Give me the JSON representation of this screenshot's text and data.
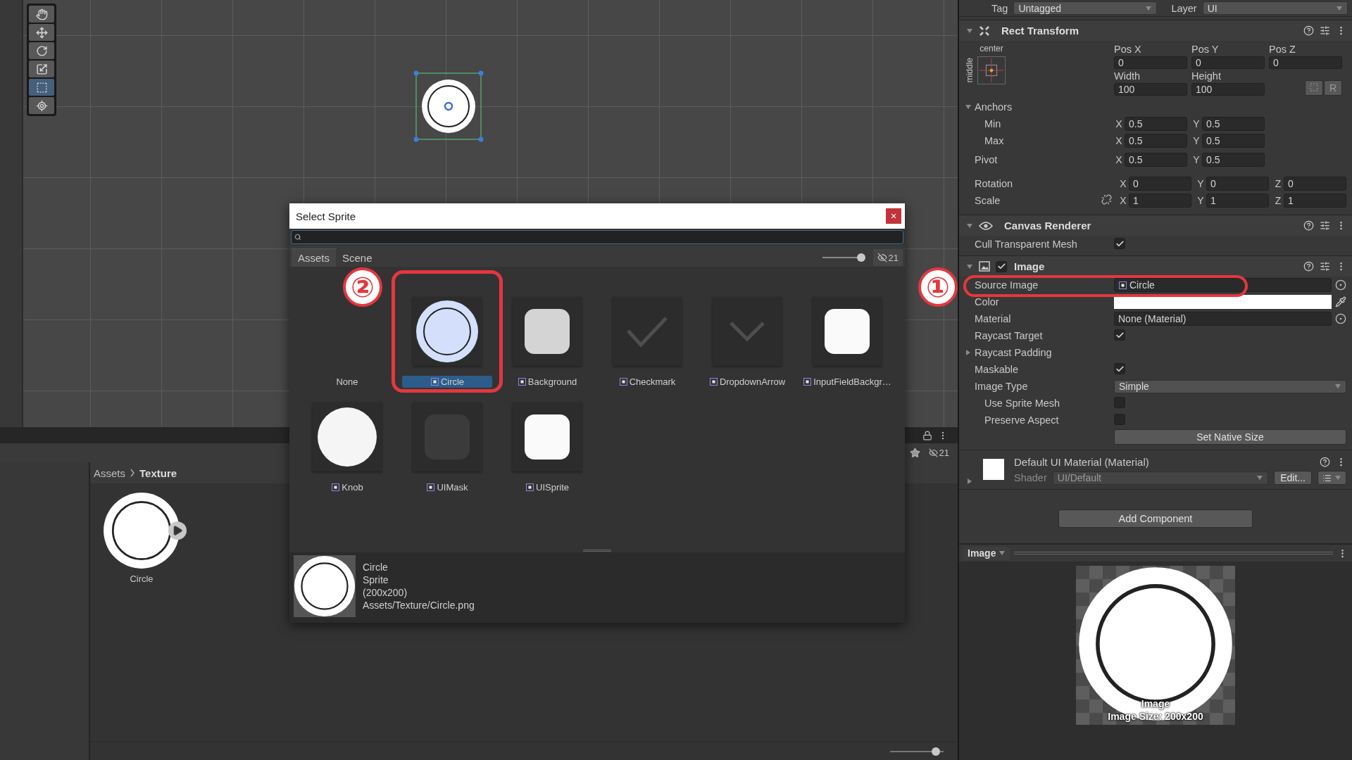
{
  "scene": {
    "tools": [
      {
        "kind": "hand",
        "selected": false
      },
      {
        "kind": "move",
        "selected": false
      },
      {
        "kind": "rotate",
        "selected": false
      },
      {
        "kind": "scale",
        "selected": false
      },
      {
        "kind": "rect",
        "selected": true
      },
      {
        "kind": "transform",
        "selected": false
      }
    ]
  },
  "project": {
    "hidden_count": "21",
    "breadcrumb": [
      "Assets",
      "Texture"
    ],
    "items": [
      {
        "name": "Circle"
      }
    ],
    "zoom": {
      "level": 0.85
    }
  },
  "dialog": {
    "title": "Select Sprite",
    "close": "×",
    "tabs": [
      {
        "label": "Assets",
        "selected": true
      },
      {
        "label": "Scene",
        "selected": false
      }
    ],
    "size": {
      "level": 0.92
    },
    "hidden_count": "21",
    "sprites": [
      {
        "name": "None",
        "kind": "none",
        "selected": false
      },
      {
        "name": "Circle",
        "kind": "ring",
        "selected": true
      },
      {
        "name": "Background",
        "kind": "rounded-gray",
        "selected": false
      },
      {
        "name": "Checkmark",
        "kind": "check",
        "selected": false
      },
      {
        "name": "DropdownArrow",
        "kind": "chevron",
        "selected": false
      },
      {
        "name": "InputFieldBackgr…",
        "kind": "rounded-white",
        "selected": false
      },
      {
        "name": "Knob",
        "kind": "disc",
        "selected": false
      },
      {
        "name": "UIMask",
        "kind": "rounded-dark",
        "selected": false
      },
      {
        "name": "UISprite",
        "kind": "rounded-white",
        "selected": false
      }
    ],
    "preview": {
      "lines": [
        "Circle",
        "Sprite",
        "(200x200)",
        "Assets/Texture/Circle.png"
      ]
    }
  },
  "inspector": {
    "tag": {
      "label": "Tag",
      "value": "Untagged"
    },
    "layer": {
      "label": "Layer",
      "value": "UI"
    },
    "rect_transform": {
      "title": "Rect Transform",
      "expanded": true,
      "preset": {
        "horizontal": "center",
        "vertical": "middle"
      },
      "size_fields": [
        {
          "label": "Pos X",
          "value": "0"
        },
        {
          "label": "Pos Y",
          "value": "0"
        },
        {
          "label": "Pos Z",
          "value": "0"
        },
        {
          "label": "Width",
          "value": "100"
        },
        {
          "label": "Height",
          "value": "100"
        }
      ],
      "raw_button": "R",
      "anchors": {
        "label": "Anchors",
        "expanded": true,
        "rows": [
          {
            "label": "Min",
            "fields": [
              {
                "axis": "X",
                "value": "0.5"
              },
              {
                "axis": "Y",
                "value": "0.5"
              }
            ]
          },
          {
            "label": "Max",
            "fields": [
              {
                "axis": "X",
                "value": "0.5"
              },
              {
                "axis": "Y",
                "value": "0.5"
              }
            ]
          }
        ]
      },
      "pivot": {
        "label": "Pivot",
        "fields": [
          {
            "axis": "X",
            "value": "0.5"
          },
          {
            "axis": "Y",
            "value": "0.5"
          }
        ]
      },
      "rows": [
        {
          "label": "Rotation",
          "constrained": null,
          "fields": [
            {
              "axis": "X",
              "value": "0"
            },
            {
              "axis": "Y",
              "value": "0"
            },
            {
              "axis": "Z",
              "value": "0"
            }
          ]
        },
        {
          "label": "Scale",
          "constrained": false,
          "fields": [
            {
              "axis": "X",
              "value": "1"
            },
            {
              "axis": "Y",
              "value": "1"
            },
            {
              "axis": "Z",
              "value": "1"
            }
          ]
        }
      ]
    },
    "canvas_renderer": {
      "title": "Canvas Renderer",
      "expanded": true,
      "rows": [
        {
          "label": "Cull Transparent Mesh",
          "kind": "checkbox",
          "checked": true
        }
      ]
    },
    "image": {
      "title": "Image",
      "expanded": true,
      "enabled": true,
      "rows": [
        {
          "label": "Source Image",
          "kind": "object",
          "value": "Circle",
          "sprite": true
        },
        {
          "label": "Color",
          "kind": "color",
          "color": "#ffffff"
        },
        {
          "label": "Material",
          "kind": "object",
          "value": "None (Material)",
          "sprite": false
        },
        {
          "label": "Raycast Target",
          "kind": "checkbox",
          "checked": true
        },
        {
          "label": "Raycast Padding",
          "kind": "foldout",
          "expanded": false
        },
        {
          "label": "Maskable",
          "kind": "checkbox",
          "checked": true
        },
        {
          "label": "Image Type",
          "kind": "dropdown",
          "value": "Simple",
          "children": [
            {
              "label": "Use Sprite Mesh",
              "kind": "checkbox",
              "checked": false
            },
            {
              "label": "Preserve Aspect",
              "kind": "checkbox",
              "checked": false
            }
          ]
        },
        {
          "label": "Set Native Size",
          "kind": "button"
        }
      ]
    },
    "material": {
      "title": "Default UI Material (Material)",
      "expanded": false,
      "shader_label": "Shader",
      "shader": "UI/Default",
      "edit": "Edit..."
    },
    "add_component": "Add Component",
    "preview": {
      "title": "Image",
      "caption": "Image",
      "size": "Image Size: 200x200"
    }
  },
  "annotations": [
    {
      "label": "②"
    },
    {
      "label": "①"
    }
  ]
}
